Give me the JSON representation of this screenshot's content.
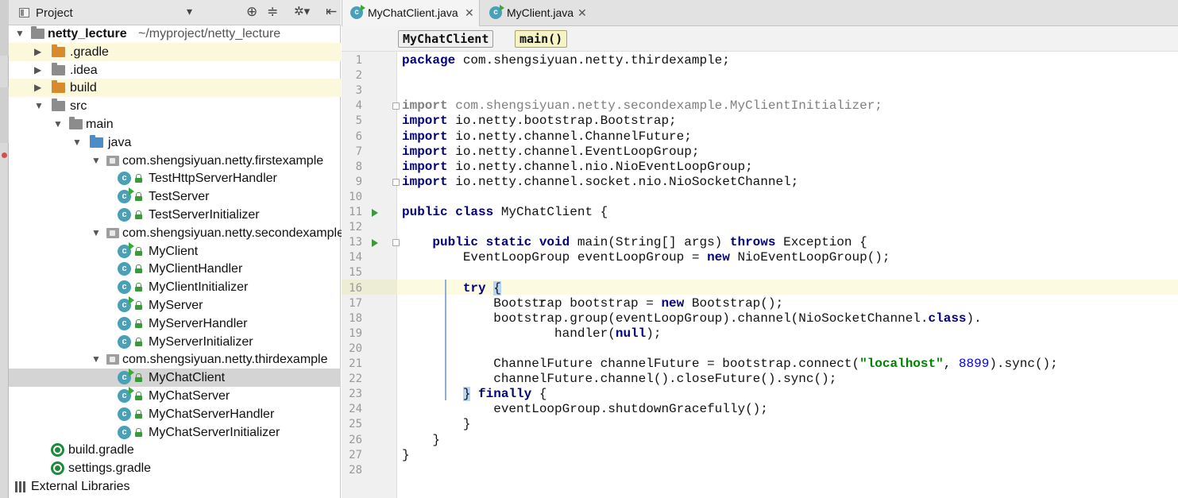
{
  "project_panel": {
    "title": "Project",
    "tools": [
      "⊕",
      "≑",
      "✲▾",
      "⇤"
    ],
    "tree": [
      {
        "label": "netty_lecture",
        "path": "~/myproject/netty_lecture",
        "type": "module",
        "arrow": "▼",
        "bold": true
      },
      {
        "label": ".gradle",
        "type": "folder-orange",
        "arrow": "▶",
        "highlight": true
      },
      {
        "label": ".idea",
        "type": "folder-gray",
        "arrow": "▶"
      },
      {
        "label": "build",
        "type": "folder-orange",
        "arrow": "▶",
        "highlight": true
      },
      {
        "label": "src",
        "type": "folder-gray",
        "arrow": "▼"
      },
      {
        "label": "main",
        "type": "folder-module",
        "arrow": "▼"
      },
      {
        "label": "java",
        "type": "folder-blue",
        "arrow": "▼"
      },
      {
        "label": "com.shengsiyuan.netty.firstexample",
        "type": "package",
        "arrow": "▼"
      },
      {
        "label": "TestHttpServerHandler",
        "type": "class"
      },
      {
        "label": "TestServer",
        "type": "class-run"
      },
      {
        "label": "TestServerInitializer",
        "type": "class"
      },
      {
        "label": "com.shengsiyuan.netty.secondexample",
        "type": "package",
        "arrow": "▼"
      },
      {
        "label": "MyClient",
        "type": "class-run"
      },
      {
        "label": "MyClientHandler",
        "type": "class"
      },
      {
        "label": "MyClientInitializer",
        "type": "class"
      },
      {
        "label": "MyServer",
        "type": "class-run"
      },
      {
        "label": "MyServerHandler",
        "type": "class"
      },
      {
        "label": "MyServerInitializer",
        "type": "class"
      },
      {
        "label": "com.shengsiyuan.netty.thirdexample",
        "type": "package",
        "arrow": "▼"
      },
      {
        "label": "MyChatClient",
        "type": "class-run",
        "selected": true
      },
      {
        "label": "MyChatServer",
        "type": "class-run"
      },
      {
        "label": "MyChatServerHandler",
        "type": "class"
      },
      {
        "label": "MyChatServerInitializer",
        "type": "class"
      },
      {
        "label": "build.gradle",
        "type": "gradle"
      },
      {
        "label": "settings.gradle",
        "type": "gradle"
      },
      {
        "label": "External Libraries",
        "type": "libs"
      }
    ]
  },
  "editor": {
    "tabs": [
      {
        "label": "MyChatClient.java",
        "active": true,
        "close": "✕"
      },
      {
        "label": "MyClient.java",
        "active": false,
        "close": "✕"
      }
    ],
    "breadcrumb": {
      "class_name": "MyChatClient",
      "method_name": "main()"
    },
    "class_icon_letter": "c",
    "lines": [
      {
        "n": "1",
        "html": "<span class=\"kw\">package</span> com.shengsiyuan.netty.thirdexample;"
      },
      {
        "n": "2",
        "html": ""
      },
      {
        "n": "3",
        "html": ""
      },
      {
        "n": "4",
        "html": "<span class=\"kw imp\" style=\"color:#808080\">import</span><span class=\"imp\"> com.shengsiyuan.netty.secondexample.MyClientInitializer;</span>",
        "fold": true
      },
      {
        "n": "5",
        "html": "<span class=\"kw\">import</span> io.netty.bootstrap.Bootstrap;"
      },
      {
        "n": "6",
        "html": "<span class=\"kw\">import</span> io.netty.channel.ChannelFuture;"
      },
      {
        "n": "7",
        "html": "<span class=\"kw\">import</span> io.netty.channel.EventLoopGroup;"
      },
      {
        "n": "8",
        "html": "<span class=\"kw\">import</span> io.netty.channel.nio.NioEventLoopGroup;"
      },
      {
        "n": "9",
        "html": "<span class=\"kw\">import</span> io.netty.channel.socket.nio.NioSocketChannel;",
        "fold": true
      },
      {
        "n": "10",
        "html": ""
      },
      {
        "n": "11",
        "html": "<span class=\"kw\">public class</span> MyChatClient {",
        "run": true
      },
      {
        "n": "12",
        "html": ""
      },
      {
        "n": "13",
        "html": "    <span class=\"kw\">public static void</span> main(String[] args) <span class=\"kw\">throws</span> Exception {",
        "run": true,
        "fold": true
      },
      {
        "n": "14",
        "html": "        EventLoopGroup eventLoopGroup = <span class=\"kw\">new</span> NioEventLoopGroup();"
      },
      {
        "n": "15",
        "html": ""
      },
      {
        "n": "16",
        "html": "        <span class=\"kw\">try</span> <span class=\"brace-hl\">{</span>",
        "current": true
      },
      {
        "n": "17",
        "html": "            Bootstrap bootstrap = <span class=\"kw\">new</span> Bootstrap();"
      },
      {
        "n": "18",
        "html": "            bootstrap.group(eventLoopGroup).channel(NioSocketChannel.<span class=\"kw\">class</span>)."
      },
      {
        "n": "19",
        "html": "                    handler(<span class=\"kw\">null</span>);"
      },
      {
        "n": "20",
        "html": ""
      },
      {
        "n": "21",
        "html": "            ChannelFuture channelFuture = bootstrap.connect(<span class=\"str\">\"localhost\"</span>, <span class=\"num\">8899</span>).sync();"
      },
      {
        "n": "22",
        "html": "            channelFuture.channel().closeFuture().sync();"
      },
      {
        "n": "23",
        "html": "        <span class=\"brace-hl\">}</span> <span class=\"kw\">finally</span> {"
      },
      {
        "n": "24",
        "html": "            eventLoopGroup.shutdownGracefully();"
      },
      {
        "n": "25",
        "html": "        }"
      },
      {
        "n": "26",
        "html": "    }"
      },
      {
        "n": "27",
        "html": "}"
      },
      {
        "n": "28",
        "html": ""
      }
    ]
  },
  "colors": {
    "keyword": "#000080",
    "string": "#008000",
    "number": "#0000ff",
    "selection": "#d4d4d4",
    "current_line": "#fcfae1"
  }
}
